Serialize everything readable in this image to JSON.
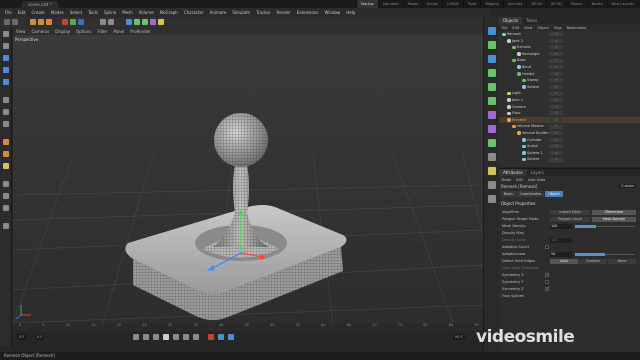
{
  "window": {
    "title": "scene.c4d *",
    "layouts": [
      "Startup",
      "Standard",
      "Model",
      "Sculpt",
      "UVEdit",
      "Paint",
      "Rigging",
      "Animate",
      "BP-UV",
      "BP-3D",
      "Motion",
      "Nodes",
      "New Layouts"
    ]
  },
  "menubar": [
    "File",
    "Edit",
    "Create",
    "Modes",
    "Select",
    "Tools",
    "Spline",
    "Mesh",
    "Volume",
    "MoGraph",
    "Character",
    "Animate",
    "Simulate",
    "Tracker",
    "Render",
    "Extensions",
    "Window",
    "Help"
  ],
  "viewport": {
    "menu": [
      "View",
      "Cameras",
      "Display",
      "Options",
      "Filter",
      "Panel",
      "ProRender"
    ],
    "label": "Perspective"
  },
  "timeline": {
    "ticks": [
      "0",
      "5",
      "10",
      "15",
      "20",
      "25",
      "30",
      "35",
      "40",
      "45",
      "50",
      "55",
      "60",
      "65",
      "70",
      "75",
      "80",
      "85",
      "90"
    ],
    "start_frame": "0 F",
    "current_frame": "0 F",
    "end_frame": "90 F"
  },
  "status": {
    "text": "Remesh Object [Remesh]"
  },
  "object_manager": {
    "tabs": [
      "Objects",
      "Takes"
    ],
    "menu": [
      "File",
      "Edit",
      "View",
      "Object",
      "Tags",
      "Bookmarks"
    ],
    "rows": [
      {
        "label": "Remesh",
        "indent": 0,
        "color": "#7fc7e8"
      },
      {
        "label": "Joint 2",
        "indent": 1,
        "color": "#cfcfcf"
      },
      {
        "label": "Extrude",
        "indent": 2,
        "color": "#67c26a"
      },
      {
        "label": "Rectangle",
        "indent": 3,
        "color": "#cfcfcf"
      },
      {
        "label": "Base",
        "indent": 2,
        "color": "#67c26a"
      },
      {
        "label": "Bend",
        "indent": 3,
        "color": "#7fc7e8"
      },
      {
        "label": "Handle",
        "indent": 3,
        "color": "#67c26a"
      },
      {
        "label": "Sweep",
        "indent": 4,
        "color": "#67c26a"
      },
      {
        "label": "Sphere",
        "indent": 4,
        "color": "#7fc7e8"
      },
      {
        "label": "Light",
        "indent": 1,
        "color": "#e0d06a"
      },
      {
        "label": "Joint 1",
        "indent": 1,
        "color": "#cfcfcf"
      },
      {
        "label": "Camera",
        "indent": 1,
        "color": "#cfcfcf"
      },
      {
        "label": "Floor",
        "indent": 1,
        "color": "#cfcfcf"
      },
      {
        "label": "Remesh",
        "indent": 1,
        "color": "#f0a24a",
        "selected": true
      },
      {
        "label": "Volume Mesher",
        "indent": 2,
        "color": "#f0a24a"
      },
      {
        "label": "Volume Builder",
        "indent": 3,
        "color": "#f0a24a"
      },
      {
        "label": "Cylinder",
        "indent": 4,
        "color": "#7fc7e8"
      },
      {
        "label": "Sculpt",
        "indent": 4,
        "color": "#7fc7e8"
      },
      {
        "label": "Sphere.1",
        "indent": 4,
        "color": "#7fc7e8"
      },
      {
        "label": "Sphere",
        "indent": 4,
        "color": "#7fc7e8"
      }
    ]
  },
  "attributes": {
    "tabs": [
      "Attributes",
      "Layers"
    ],
    "menu": [
      "Mode",
      "Edit",
      "User Data"
    ],
    "object_name": "Remesh [Remesh]",
    "mode_value": "Custom",
    "subtabs": [
      "Basic",
      "Coordinates",
      "Object"
    ],
    "section_title": "Object Properties",
    "algorithm": {
      "label": "Algorithm",
      "options": [
        "Instant Mesh",
        "ZRemesher"
      ]
    },
    "polygon_target_mode": {
      "label": "Polygon Target Mode",
      "options": [
        "Polygon Count",
        "Mesh Density"
      ]
    },
    "mesh_density": {
      "label": "Mesh Density",
      "value": "100",
      "fraction": 0.35
    },
    "density_map": {
      "label": "Density Map"
    },
    "density_scale": {
      "label": "Density Scale",
      "value": "100"
    },
    "adaptive_count": {
      "label": "Adaptive Count"
    },
    "adaptiveness": {
      "label": "Adaptiveness",
      "value": "50",
      "fraction": 0.5
    },
    "detect_hard_edges": {
      "label": "Detect Hard Edges",
      "options": [
        "Auto",
        "Enabled",
        "None"
      ]
    },
    "hard_edge_threshold": {
      "label": "Hard Edge Threshold"
    },
    "symmetry_x": {
      "label": "Symmetry X",
      "checked": true
    },
    "symmetry_y": {
      "label": "Symmetry Y",
      "checked": false
    },
    "symmetry_z": {
      "label": "Symmetry Z",
      "checked": true
    },
    "fuse_splines": {
      "label": "Fuse Splines"
    }
  },
  "watermark": "videosmile",
  "colors": {
    "accent": "#4b7fc0",
    "selection": "#f0a24a",
    "enabled": "#63c24a"
  }
}
